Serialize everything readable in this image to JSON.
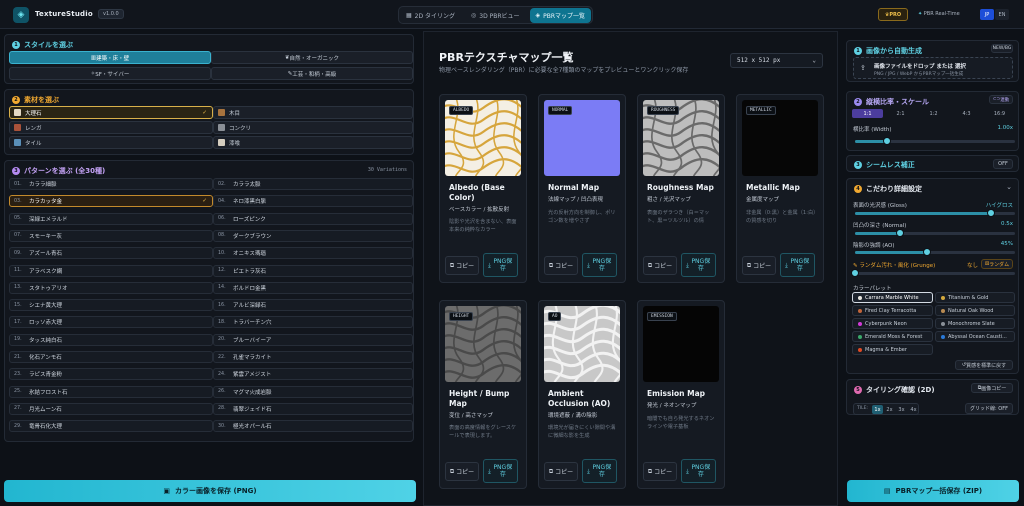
{
  "app": {
    "name": "TextureStudio",
    "version": "v1.0.0"
  },
  "tabs": [
    {
      "label": "2D タイリング"
    },
    {
      "label": "3D PBRビュー"
    },
    {
      "label": "PBRマップ一覧"
    }
  ],
  "header": {
    "pro": "PRO",
    "realtime": "PBR Real-Time",
    "lang": [
      "JP",
      "EN"
    ]
  },
  "style_section": {
    "num": "1",
    "title": "スタイルを選ぶ",
    "items": [
      "建築・床・壁",
      "自然・オーガニック",
      "SF・サイバー",
      "工芸・和柄・高級"
    ]
  },
  "material_section": {
    "num": "2",
    "title": "素材を選ぶ",
    "items": [
      {
        "label": "大理石",
        "color": "#e4d8c4"
      },
      {
        "label": "木目",
        "color": "#a7733e"
      },
      {
        "label": "レンガ",
        "color": "#a9523a"
      },
      {
        "label": "コンクリ",
        "color": "#8a8f96"
      },
      {
        "label": "タイル",
        "color": "#5a8fb8"
      },
      {
        "label": "漆喰",
        "color": "#d4cdbf"
      }
    ]
  },
  "pattern_section": {
    "num": "3",
    "title": "パターンを選ぶ (全30種)",
    "count": "30 Variations",
    "items": [
      {
        "n": "01.",
        "label": "カララ細脈"
      },
      {
        "n": "02.",
        "label": "カララ太脈"
      },
      {
        "n": "03.",
        "label": "カラカッタ金"
      },
      {
        "n": "04.",
        "label": "ネロ漆黒白脈"
      },
      {
        "n": "05.",
        "label": "深緑エメラルド"
      },
      {
        "n": "06.",
        "label": "ローズピンク"
      },
      {
        "n": "07.",
        "label": "スモーキー灰"
      },
      {
        "n": "08.",
        "label": "ダークブラウン"
      },
      {
        "n": "09.",
        "label": "アズール青石"
      },
      {
        "n": "10.",
        "label": "オニキス瑪瑙"
      },
      {
        "n": "11.",
        "label": "アラベスク網"
      },
      {
        "n": "12.",
        "label": "ピエトラ灰石"
      },
      {
        "n": "13.",
        "label": "スタトゥアリオ"
      },
      {
        "n": "14.",
        "label": "ボルドロ金黒"
      },
      {
        "n": "15.",
        "label": "シエナ黄大理"
      },
      {
        "n": "16.",
        "label": "アルビ深緑石"
      },
      {
        "n": "17.",
        "label": "ロッソ赤大理"
      },
      {
        "n": "18.",
        "label": "トラバーチン穴"
      },
      {
        "n": "19.",
        "label": "タッス純白石"
      },
      {
        "n": "20.",
        "label": "ブルーバイーア"
      },
      {
        "n": "21.",
        "label": "化石アンモ石"
      },
      {
        "n": "22.",
        "label": "孔雀マラカイト"
      },
      {
        "n": "23.",
        "label": "ラピス青金粉"
      },
      {
        "n": "24.",
        "label": "紫雲アメジスト"
      },
      {
        "n": "25.",
        "label": "氷結フロスト石"
      },
      {
        "n": "26.",
        "label": "マグマ火成岩脈"
      },
      {
        "n": "27.",
        "label": "月光ムーン石"
      },
      {
        "n": "28.",
        "label": "翡翠ジェイド石"
      },
      {
        "n": "29.",
        "label": "竜骨石化大理"
      },
      {
        "n": "30.",
        "label": "極光オパール石"
      }
    ]
  },
  "save_color": "カラー画像を保存 (PNG)",
  "main": {
    "title": "PBRテクスチャマップ一覧",
    "subtitle": "物理ベースレンダリング（PBR）に必要な全7種類のマップをプレビューとワンクリック保存",
    "resolution": "512 x 512 px"
  },
  "maps": [
    {
      "tag": "ALBEDO",
      "title": "Albedo (Base Color)",
      "sub": "ベースカラー / 拡散反射",
      "desc": "陰影や光沢を含まない、表面本来の純粋なカラー"
    },
    {
      "tag": "NORMAL",
      "title": "Normal Map",
      "sub": "法線マップ / 凹凸表現",
      "desc": "光の反射方向を制御し、ポリゴン数を増やさず"
    },
    {
      "tag": "ROUGHNESS",
      "title": "Roughness Map",
      "sub": "粗さ / 光沢マップ",
      "desc": "表面のザラつき（白＝マット、黒＝ツルツル）の情"
    },
    {
      "tag": "METALLIC",
      "title": "Metallic Map",
      "sub": "金属度マップ",
      "desc": "非金属（0:黒）と金属（1:白）の質感を切り"
    },
    {
      "tag": "HEIGHT",
      "title": "Height / Bump Map",
      "sub": "変位 / 高さマップ",
      "desc": "表面の高度情報をグレースケールで表現します。"
    },
    {
      "tag": "AO",
      "title": "Ambient Occlusion (AO)",
      "sub": "環境遮蔽 / 溝の陰影",
      "desc": "環境光が届きにくい隙間や溝に微細な影を生成"
    },
    {
      "tag": "EMISSION",
      "title": "Emission Map",
      "sub": "発光 / ネオンマップ",
      "desc": "暗闇でも自ら発光するネオンラインや電子基板"
    }
  ],
  "card_copy": "コピー",
  "card_png": "PNG保存",
  "right": {
    "auto": {
      "num": "1",
      "title": "画像から自動生成",
      "badge": "NEW/BG",
      "drop": "画像ファイルをドロップ または 選択",
      "drop_sub": "PNG / JPG / WebP からPBRマップ一括生成"
    },
    "ratio": {
      "num": "2",
      "title": "縦横比率・スケール",
      "link": "連動",
      "items": [
        "1:1",
        "2:1",
        "1:2",
        "4:3",
        "16:9"
      ],
      "scale_label": "横比率 (Width)",
      "scale_value": "1.00x",
      "scale_fraction": 0.2
    },
    "seamless": {
      "num": "3",
      "title": "シームレス補正",
      "state": "OFF"
    },
    "detail": {
      "num": "4",
      "title": "こだわり詳細設定",
      "gloss": {
        "label": "表面の光沢感 (Gloss)",
        "value": "ハイグロス",
        "fraction": 0.85
      },
      "depth": {
        "label": "凹凸の深さ (Normal)",
        "value": "0.5x",
        "fraction": 0.28
      },
      "ao": {
        "label": "陰影の強調 (AO)",
        "value": "45%",
        "fraction": 0.45
      },
      "grunge": {
        "label": "ランダム汚れ・風化 (Grunge)",
        "value": "なし",
        "random": "ランダム",
        "fraction": 0
      },
      "palette_label": "カラーパレット",
      "palettes": [
        {
          "label": "Carrara Marble White",
          "color": "#e8e6e0"
        },
        {
          "label": "Titanium & Gold",
          "color": "#d4a93c"
        },
        {
          "label": "Fired Clay Terracotta",
          "color": "#c0643a"
        },
        {
          "label": "Natural Oak Wood",
          "color": "#b88a52"
        },
        {
          "label": "Cyberpunk Neon",
          "color": "#d23ad8"
        },
        {
          "label": "Monochrome Slate",
          "color": "#8a9098"
        },
        {
          "label": "Emerald Moss & Forest",
          "color": "#3aa86a"
        },
        {
          "label": "Abyssal Ocean Causti...",
          "color": "#2a7ad8"
        },
        {
          "label": "Magma & Ember",
          "color": "#e04a24"
        }
      ],
      "reset": "質感を標準に戻す"
    },
    "tiling": {
      "num": "5",
      "title": "タイリング確認 (2D)",
      "copy": "画像コピー",
      "tile_label": "TILE:",
      "tiles": [
        "1x",
        "2x",
        "3x",
        "4x"
      ],
      "grid": "グリッド線: OFF"
    }
  },
  "save_zip": "PBRマップ一括保存 (ZIP)"
}
